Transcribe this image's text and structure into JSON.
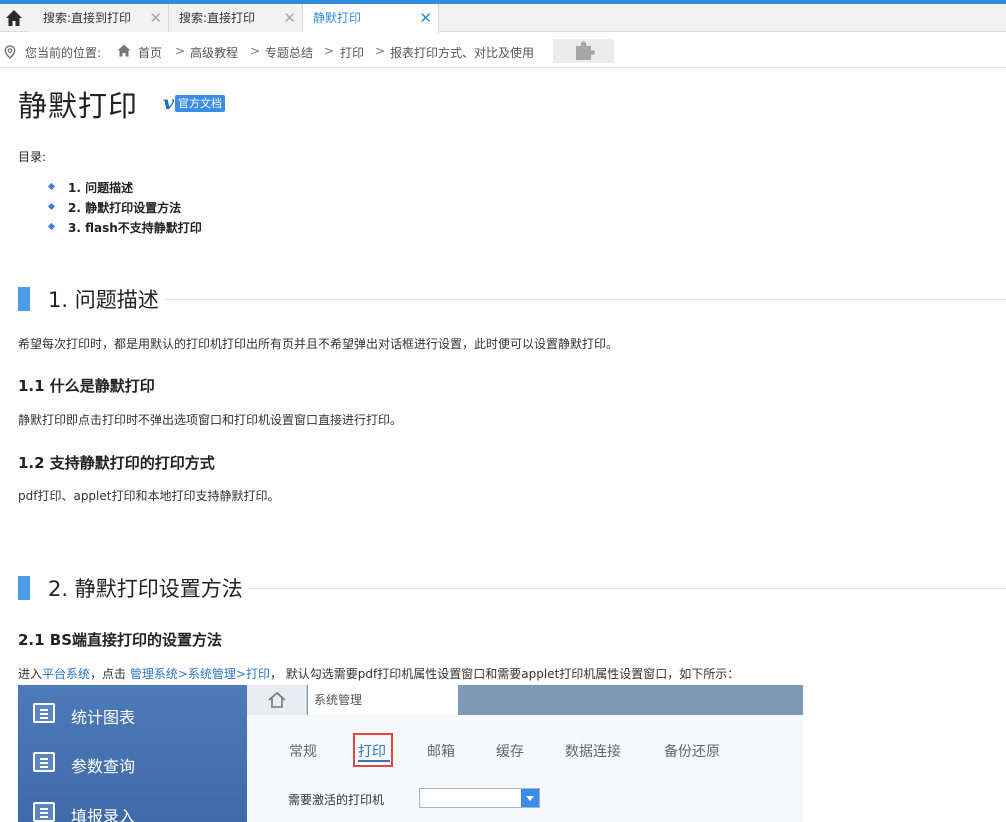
{
  "tabs": [
    {
      "label": "搜索:直接到打印",
      "close": "✕"
    },
    {
      "label": "搜索:直接打印",
      "close": "✕"
    },
    {
      "label": "静默打印",
      "close": "✕"
    }
  ],
  "breadcrumb": {
    "location_label": "您当前的位置:",
    "sep": ">",
    "items": [
      "首页",
      "高级教程",
      "专题总结",
      "打印",
      "报表打印方式、对比及使用"
    ]
  },
  "page": {
    "title": "静默打印",
    "doc_badge": "官方文档",
    "doc_logo": "v"
  },
  "toc": {
    "label": "目录:",
    "items": [
      "1. 问题描述",
      "2. 静默打印设置方法",
      "3. flash不支持静默打印"
    ]
  },
  "sections": {
    "s1": {
      "title": "1. 问题描述",
      "intro": "希望每次打印时，都是用默认的打印机打印出所有页并且不希望弹出对话框进行设置，此时便可以设置静默打印。",
      "sub1_title": "1.1 什么是静默打印",
      "sub1_text": "静默打印即点击打印时不弹出选项窗口和打印机设置窗口直接进行打印。",
      "sub2_title": "1.2 支持静默打印的打印方式",
      "sub2_text": "pdf打印、applet打印和本地打印支持静默打印。"
    },
    "s2": {
      "title": "2. 静默打印设置方法",
      "sub1_title": "2.1 BS端直接打印的设置方法",
      "p_prefix": "进入",
      "p_link1": "平台系统",
      "p_mid": "，点击 ",
      "p_link2": "管理系统>系统管理>打印",
      "p_suffix": "， 默认勾选需要pdf打印机属性设置窗口和需要applet打印机属性设置窗口，如下所示："
    }
  },
  "screenshot": {
    "sidebar": [
      "统计图表",
      "参数查询",
      "填报录入"
    ],
    "tab": "系统管理",
    "subtabs": [
      "常规",
      "打印",
      "邮箱",
      "缓存",
      "数据连接",
      "备份还原"
    ],
    "active_subtab": "打印",
    "field_label": "需要激活的打印机",
    "field_value": ""
  },
  "colors": {
    "accent": "#2f8ce0",
    "heading_bar": "#4a9be8",
    "link": "#2f74c8",
    "highlight_box": "#e04646"
  }
}
